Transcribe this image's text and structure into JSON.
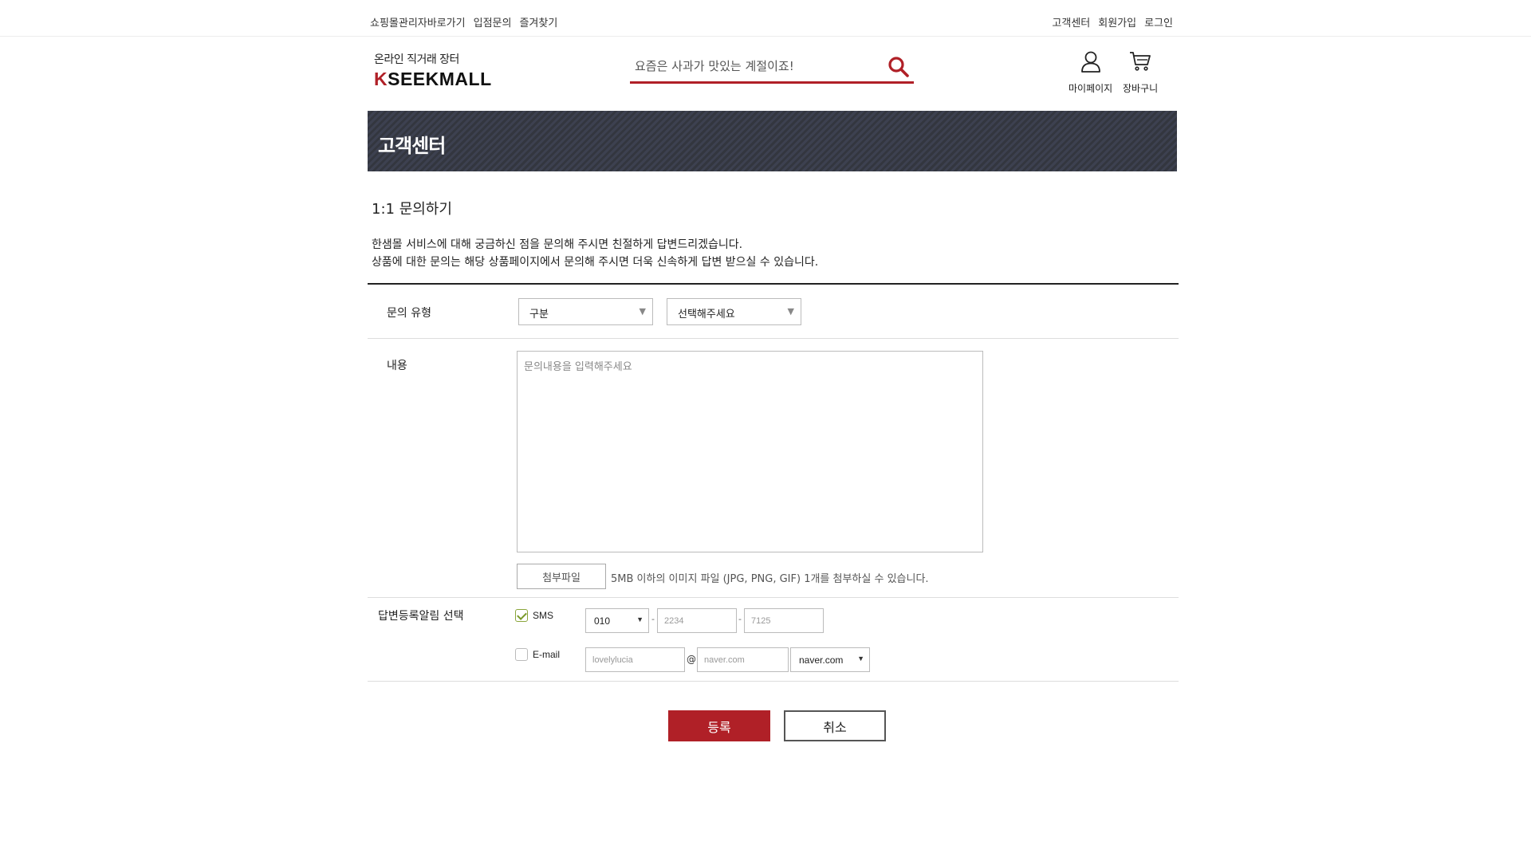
{
  "top_nav": {
    "left": [
      "쇼핑몰관리자바로가기",
      "입점문의",
      "즐겨찾기"
    ],
    "right": [
      "고객센터",
      "회원가입",
      "로그인"
    ]
  },
  "logo": {
    "sub": "온라인 직거래 장터",
    "k": "K",
    "rest": "SEEKMALL"
  },
  "search": {
    "placeholder": "요즘은 사과가 맛있는 계절이죠!",
    "icon": "search-icon"
  },
  "utils": {
    "mypage": "마이페이지",
    "cart": "장바구니"
  },
  "banner": {
    "title": "고객센터"
  },
  "page": {
    "heading": "1:1 문의하기",
    "intro_1": "한샘몰 서비스에 대해 궁금하신 점을 문의해 주시면 친절하게 답변드리겠습니다.",
    "intro_2": "상품에 대한 문의는 해당 상품페이지에서 문의해 주시면 더욱 신속하게 답변 받으실 수 있습니다."
  },
  "form": {
    "type_label": "문의 유형",
    "select_category": "구분",
    "select_detail": "선택해주세요",
    "content_label": "내용",
    "content_placeholder": "문의내용을 입력해주세요",
    "attach_label": "첨부파일",
    "attach_note": "5MB 이하의 이미지 파일 (JPG, PNG, GIF) 1개를 첨부하실 수 있습니다.",
    "notify_label": "답변등록알림 선택",
    "sms": {
      "label": "SMS",
      "checked": true,
      "prefix": "010",
      "mid": "2234",
      "last": "7125",
      "dash": "-"
    },
    "email": {
      "label": "E-mail",
      "checked": false,
      "id": "lovelylucia",
      "at": "@",
      "domain": "naver.com",
      "domain_select": "naver.com"
    }
  },
  "buttons": {
    "submit": "등록",
    "cancel": "취소"
  },
  "colors": {
    "accent": "#b02027",
    "banner": "#3d4150"
  }
}
